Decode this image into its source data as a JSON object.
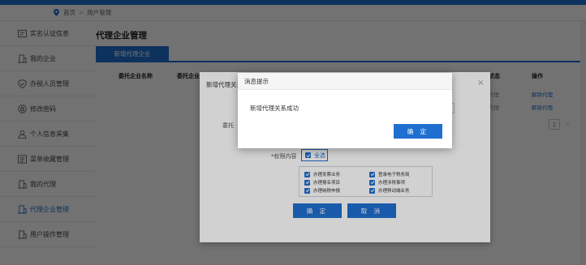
{
  "breadcrumb": {
    "home": "首页",
    "separator": ">",
    "current": "用户管理"
  },
  "sidebar": {
    "items": [
      {
        "label": "实名认证信息",
        "icon": "id-card-icon"
      },
      {
        "label": "我的企业",
        "icon": "building-icon"
      },
      {
        "label": "办税人员管理",
        "icon": "shield-check-icon"
      },
      {
        "label": "修改密码",
        "icon": "lock-icon"
      },
      {
        "label": "个人信息采集",
        "icon": "user-icon"
      },
      {
        "label": "菜单收藏管理",
        "icon": "star-list-icon"
      },
      {
        "label": "我的代理",
        "icon": "building-icon"
      },
      {
        "label": "代理企业管理",
        "icon": "building-icon"
      },
      {
        "label": "用户操作管理",
        "icon": "building-icon"
      }
    ],
    "active_index": 7
  },
  "main": {
    "title": "代理企业管理",
    "new_button": "新增代理企业",
    "table": {
      "headers": [
        "委托企业名称",
        "委托企业",
        "状态",
        "操作"
      ],
      "rows": [
        {
          "status": "代理",
          "action": "解除代理"
        },
        {
          "status": "代理",
          "action": "解除代理"
        }
      ]
    },
    "pager": {
      "page": "1",
      "next": "›"
    }
  },
  "dialog": {
    "title": "新增代理关系",
    "close": "×",
    "field_label": "委托",
    "perm_label": "*权限内容",
    "select_all": "全选",
    "permissions": [
      "办理发票业务",
      "登录电子税务局",
      "办理报名项目",
      "办理涉税事项",
      "办理纳税申报",
      "办理移动端业务"
    ],
    "confirm": "确 定",
    "cancel": "取 消"
  },
  "toast": {
    "title": "消息提示",
    "message": "新增代理关系成功",
    "ok": "确 定"
  },
  "colors": {
    "accent": "#1f6fd0",
    "overlay": "rgba(0,0,0,0.45)"
  }
}
